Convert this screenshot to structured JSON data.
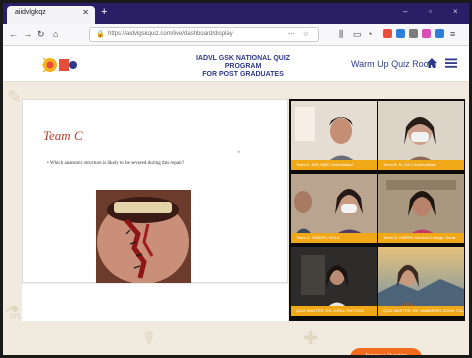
{
  "browser": {
    "tab_title": "aiidvlgkqz",
    "new_tab": "+",
    "url": "https://aidvlgskquiz.com/live/dashboard/display",
    "win_controls": [
      "–",
      "▫",
      "×"
    ]
  },
  "site": {
    "title_line1": "IADVL GSK NATIONAL QUIZ PROGRAM",
    "title_line2": "FOR POST GRADUATES",
    "room_label": "Warm Up Quiz Room"
  },
  "slide": {
    "heading": "Team C",
    "bullet": "• Which anatomic structure is likely to be severed during this repair?"
  },
  "participants": [
    {
      "label": "Team A: NHL MMC Ahmedabad"
    },
    {
      "label": "Team B: B.J.M.C Ahmedabad"
    },
    {
      "label": "Team C: GMERS, SOLA"
    },
    {
      "label": "Team D: GMERS Medical College, Surat"
    },
    {
      "label": "QUIZ MASTER: DR. DIPALI RATHOD"
    },
    {
      "label": "QUIZ MASTER: DR. AMBARISH GOHIL TOLANI"
    }
  ],
  "actions": {
    "ask_question": "Answer a Question"
  },
  "colors": {
    "browser_top": "#2a1e66",
    "brand_blue": "#2f3a8a",
    "label_orange": "#f0a718",
    "heading_red": "#c0392b",
    "cta_orange": "#f26a1b",
    "background": "#f1eadf"
  }
}
